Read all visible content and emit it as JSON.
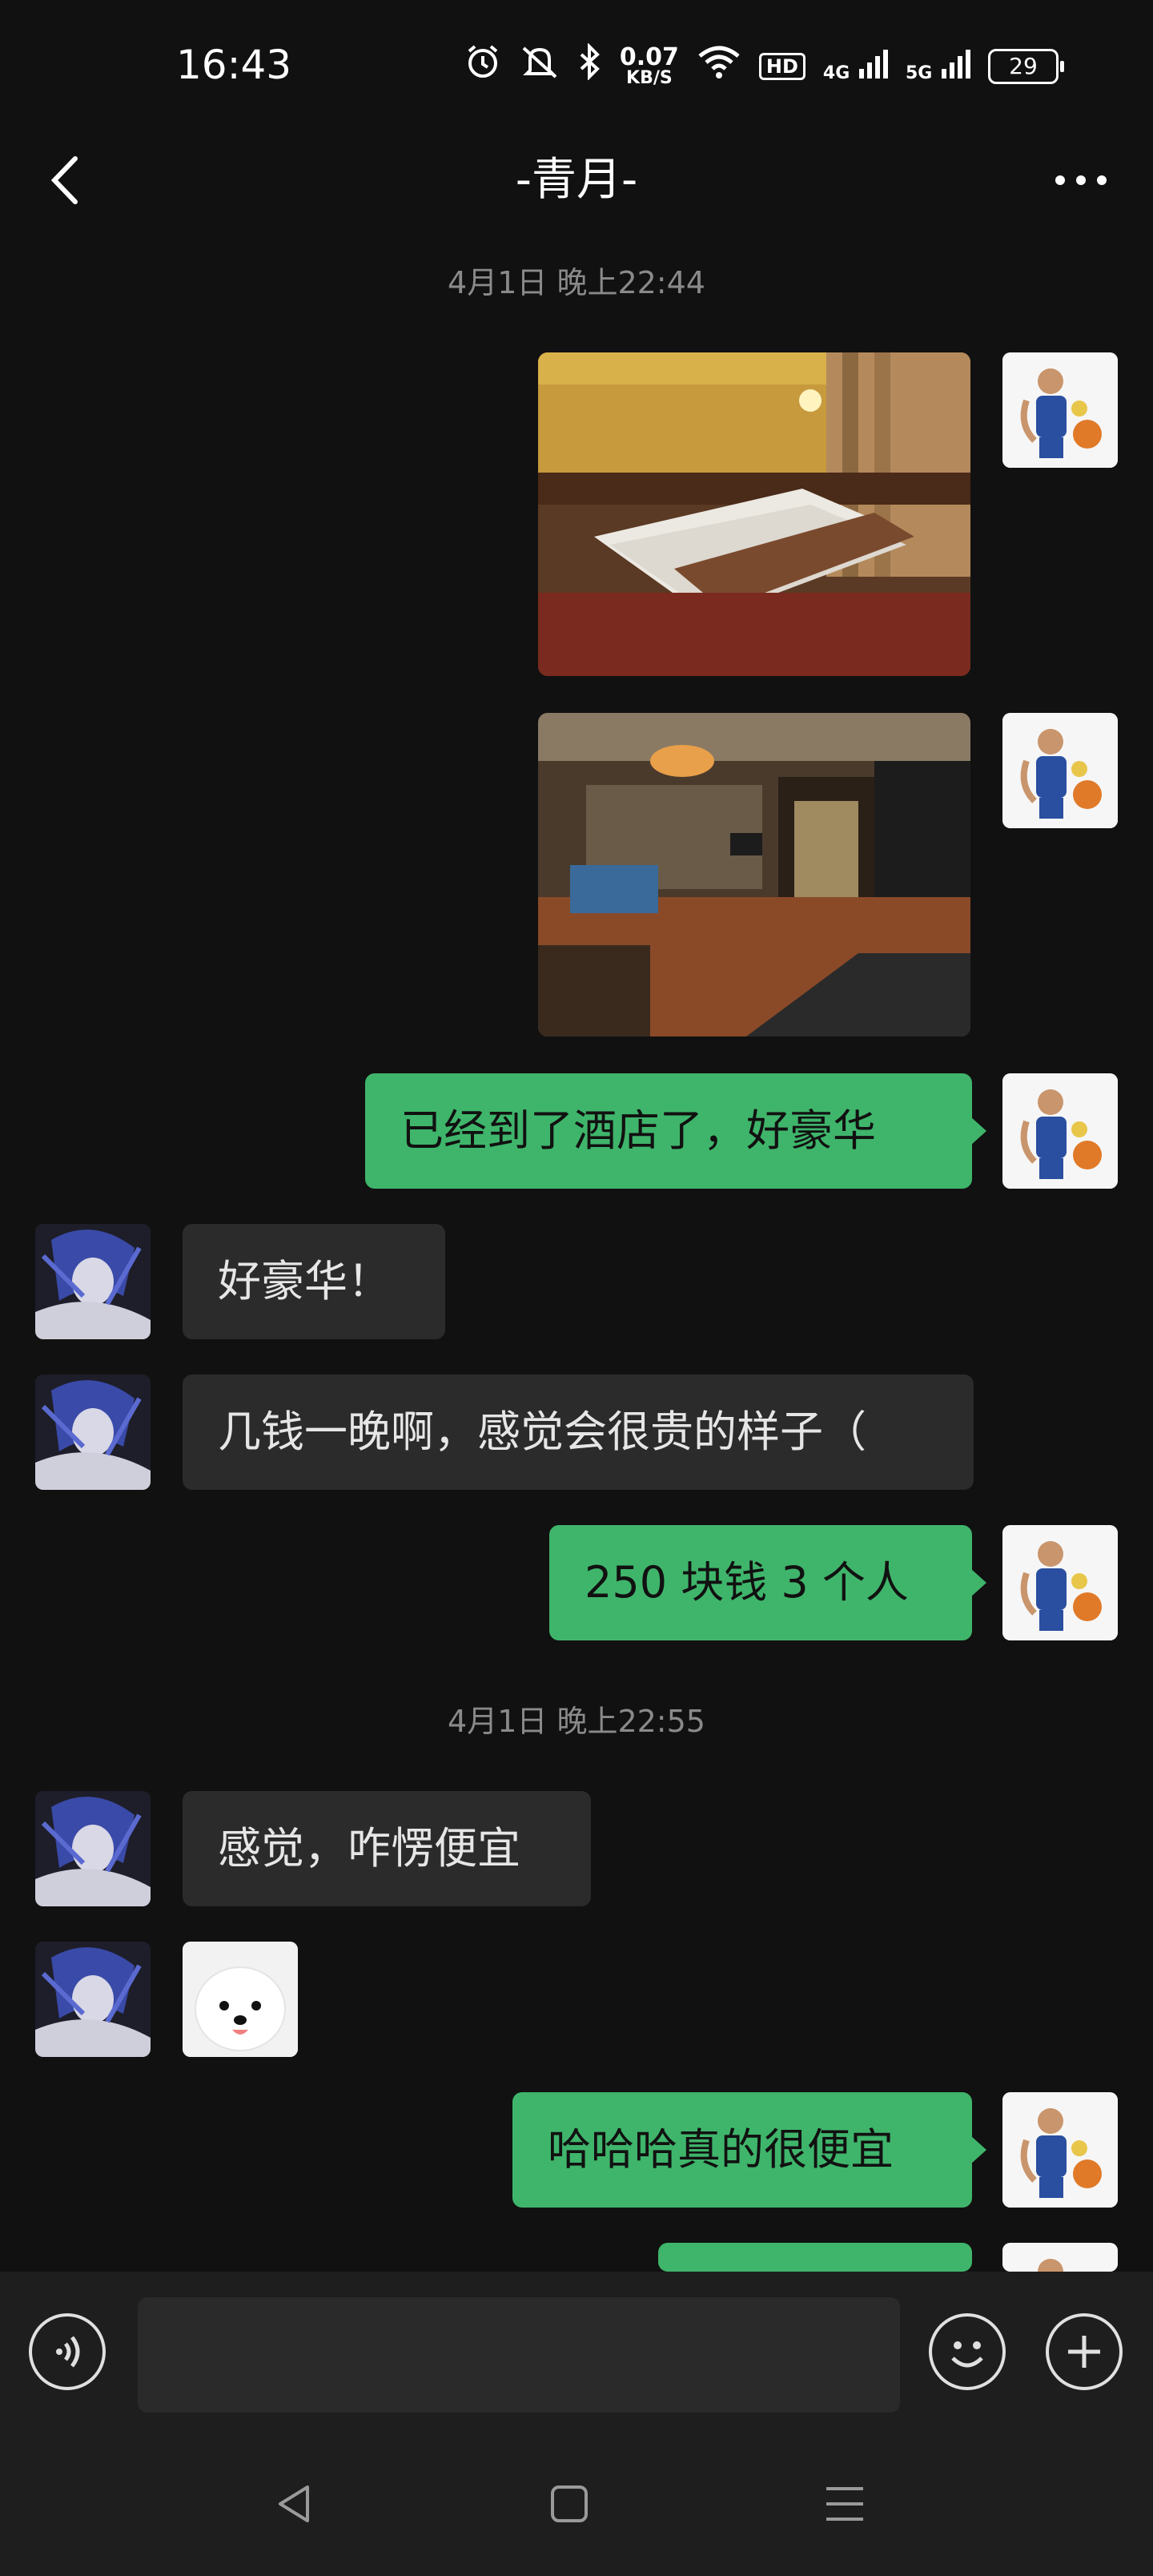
{
  "status_bar": {
    "time": "16:43",
    "net_speed_value": "0.07",
    "net_speed_unit": "KB/S",
    "hd_label": "HD",
    "net1": "4G",
    "net2": "5G",
    "battery": "29",
    "icons": [
      "alarm-icon",
      "mute-icon",
      "bluetooth-icon",
      "wifi-icon",
      "signal-icon"
    ]
  },
  "header": {
    "title": "-青月-"
  },
  "messages": {
    "ts1": "4月1日 晚上22:44",
    "m3": "已经到了酒店了，好豪华",
    "m4": "好豪华！",
    "m5": "几钱一晚啊，感觉会很贵的样子（",
    "m6": "250 块钱 3 个人",
    "ts2": "4月1日 晚上22:55",
    "m7": "感觉，咋愣便宜",
    "m9": "哈哈哈真的很便宜"
  },
  "colors": {
    "background": "#111111",
    "bubble_out": "#3fb56b",
    "bubble_in": "#2b2b2b"
  }
}
